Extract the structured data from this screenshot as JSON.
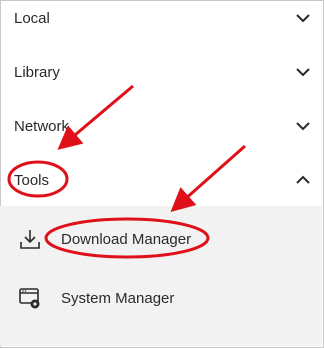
{
  "menu": {
    "items": [
      {
        "label": "Local",
        "icon": "chevron-down-icon"
      },
      {
        "label": "Library",
        "icon": "chevron-down-icon"
      },
      {
        "label": "Network",
        "icon": "chevron-down-icon"
      },
      {
        "label": "Tools",
        "icon": "chevron-up-icon"
      }
    ]
  },
  "submenu": {
    "items": [
      {
        "label": "Download Manager",
        "icon": "download-icon"
      },
      {
        "label": "System Manager",
        "icon": "system-manager-icon"
      }
    ]
  },
  "colors": {
    "annotation": "#e0101a",
    "submenu_bg": "#f2f2f2",
    "text": "#2a2a2a"
  }
}
